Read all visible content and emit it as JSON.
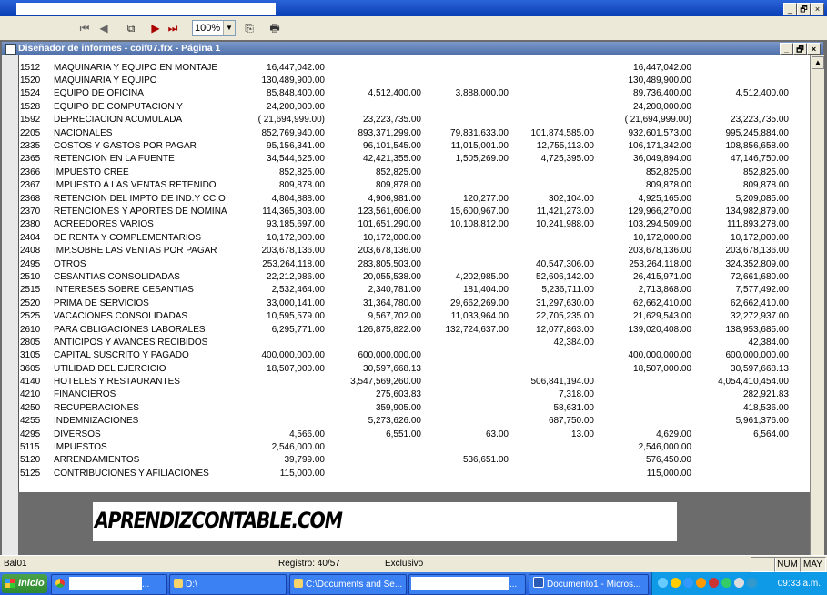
{
  "window": {
    "title": "Diseñador de informes - coif07.frx - Página 1",
    "controls": [
      "_",
      "🗗",
      "×"
    ]
  },
  "toolbar": {
    "zoom": "100%"
  },
  "report": {
    "rows": [
      {
        "code": "1512",
        "name": "MAQUINARIA Y EQUIPO EN MONTAJE",
        "c1": "16,447,042.00",
        "c2": "",
        "c3": "",
        "c4": "",
        "c5": "16,447,042.00",
        "c6": ""
      },
      {
        "code": "1520",
        "name": "MAQUINARIA Y EQUIPO",
        "c1": "130,489,900.00",
        "c2": "",
        "c3": "",
        "c4": "",
        "c5": "130,489,900.00",
        "c6": ""
      },
      {
        "code": "1524",
        "name": "EQUIPO DE OFICINA",
        "c1": "85,848,400.00",
        "c2": "4,512,400.00",
        "c3": "3,888,000.00",
        "c4": "",
        "c5": "89,736,400.00",
        "c6": "4,512,400.00"
      },
      {
        "code": "1528",
        "name": "EQUIPO DE COMPUTACION Y",
        "c1": "24,200,000.00",
        "c2": "",
        "c3": "",
        "c4": "",
        "c5": "24,200,000.00",
        "c6": ""
      },
      {
        "code": "1592",
        "name": "DEPRECIACION ACUMULADA",
        "c1": "(    21,694,999.00)",
        "c2": "23,223,735.00",
        "c3": "",
        "c4": "",
        "c5": "(    21,694,999.00)",
        "c6": "23,223,735.00"
      },
      {
        "code": "2205",
        "name": "NACIONALES",
        "c1": "852,769,940.00",
        "c2": "893,371,299.00",
        "c3": "79,831,633.00",
        "c4": "101,874,585.00",
        "c5": "932,601,573.00",
        "c6": "995,245,884.00"
      },
      {
        "code": "2335",
        "name": "COSTOS Y GASTOS POR PAGAR",
        "c1": "95,156,341.00",
        "c2": "96,101,545.00",
        "c3": "11,015,001.00",
        "c4": "12,755,113.00",
        "c5": "106,171,342.00",
        "c6": "108,856,658.00"
      },
      {
        "code": "2365",
        "name": "RETENCION EN LA FUENTE",
        "c1": "34,544,625.00",
        "c2": "42,421,355.00",
        "c3": "1,505,269.00",
        "c4": "4,725,395.00",
        "c5": "36,049,894.00",
        "c6": "47,146,750.00"
      },
      {
        "code": "2366",
        "name": "IMPUESTO CREE",
        "c1": "852,825.00",
        "c2": "852,825.00",
        "c3": "",
        "c4": "",
        "c5": "852,825.00",
        "c6": "852,825.00"
      },
      {
        "code": "2367",
        "name": "IMPUESTO A LAS VENTAS RETENIDO",
        "c1": "809,878.00",
        "c2": "809,878.00",
        "c3": "",
        "c4": "",
        "c5": "809,878.00",
        "c6": "809,878.00"
      },
      {
        "code": "2368",
        "name": "RETENCION DEL IMPTO DE IND.Y CCIO",
        "c1": "4,804,888.00",
        "c2": "4,906,981.00",
        "c3": "120,277.00",
        "c4": "302,104.00",
        "c5": "4,925,165.00",
        "c6": "5,209,085.00"
      },
      {
        "code": "2370",
        "name": "RETENCIONES Y APORTES DE NOMINA",
        "c1": "114,365,303.00",
        "c2": "123,561,606.00",
        "c3": "15,600,967.00",
        "c4": "11,421,273.00",
        "c5": "129,966,270.00",
        "c6": "134,982,879.00"
      },
      {
        "code": "2380",
        "name": "ACREEDORES VARIOS",
        "c1": "93,185,697.00",
        "c2": "101,651,290.00",
        "c3": "10,108,812.00",
        "c4": "10,241,988.00",
        "c5": "103,294,509.00",
        "c6": "111,893,278.00"
      },
      {
        "code": "2404",
        "name": "DE RENTA Y COMPLEMENTARIOS",
        "c1": "10,172,000.00",
        "c2": "10,172,000.00",
        "c3": "",
        "c4": "",
        "c5": "10,172,000.00",
        "c6": "10,172,000.00"
      },
      {
        "code": "2408",
        "name": "IMP.SOBRE LAS VENTAS POR PAGAR",
        "c1": "203,678,136.00",
        "c2": "203,678,136.00",
        "c3": "",
        "c4": "",
        "c5": "203,678,136.00",
        "c6": "203,678,136.00"
      },
      {
        "code": "2495",
        "name": "OTROS",
        "c1": "253,264,118.00",
        "c2": "283,805,503.00",
        "c3": "",
        "c4": "40,547,306.00",
        "c5": "253,264,118.00",
        "c6": "324,352,809.00"
      },
      {
        "code": "2510",
        "name": "CESANTIAS CONSOLIDADAS",
        "c1": "22,212,986.00",
        "c2": "20,055,538.00",
        "c3": "4,202,985.00",
        "c4": "52,606,142.00",
        "c5": "26,415,971.00",
        "c6": "72,661,680.00"
      },
      {
        "code": "2515",
        "name": "INTERESES SOBRE CESANTIAS",
        "c1": "2,532,464.00",
        "c2": "2,340,781.00",
        "c3": "181,404.00",
        "c4": "5,236,711.00",
        "c5": "2,713,868.00",
        "c6": "7,577,492.00"
      },
      {
        "code": "2520",
        "name": "PRIMA DE SERVICIOS",
        "c1": "33,000,141.00",
        "c2": "31,364,780.00",
        "c3": "29,662,269.00",
        "c4": "31,297,630.00",
        "c5": "62,662,410.00",
        "c6": "62,662,410.00"
      },
      {
        "code": "2525",
        "name": "VACACIONES CONSOLIDADAS",
        "c1": "10,595,579.00",
        "c2": "9,567,702.00",
        "c3": "11,033,964.00",
        "c4": "22,705,235.00",
        "c5": "21,629,543.00",
        "c6": "32,272,937.00"
      },
      {
        "code": "2610",
        "name": "PARA OBLIGACIONES LABORALES",
        "c1": "6,295,771.00",
        "c2": "126,875,822.00",
        "c3": "132,724,637.00",
        "c4": "12,077,863.00",
        "c5": "139,020,408.00",
        "c6": "138,953,685.00"
      },
      {
        "code": "2805",
        "name": "ANTICIPOS Y AVANCES RECIBIDOS",
        "c1": "",
        "c2": "",
        "c3": "",
        "c4": "42,384.00",
        "c5": "",
        "c6": "42,384.00"
      },
      {
        "code": "3105",
        "name": "CAPITAL SUSCRITO Y PAGADO",
        "c1": "400,000,000.00",
        "c2": "600,000,000.00",
        "c3": "",
        "c4": "",
        "c5": "400,000,000.00",
        "c6": "600,000,000.00"
      },
      {
        "code": "3605",
        "name": "UTILIDAD DEL EJERCICIO",
        "c1": "18,507,000.00",
        "c2": "30,597,668.13",
        "c3": "",
        "c4": "",
        "c5": "18,507,000.00",
        "c6": "30,597,668.13"
      },
      {
        "code": "4140",
        "name": "HOTELES Y RESTAURANTES",
        "c1": "",
        "c2": "3,547,569,260.00",
        "c3": "",
        "c4": "506,841,194.00",
        "c5": "",
        "c6": "4,054,410,454.00"
      },
      {
        "code": "4210",
        "name": "FINANCIEROS",
        "c1": "",
        "c2": "275,603.83",
        "c3": "",
        "c4": "7,318.00",
        "c5": "",
        "c6": "282,921.83"
      },
      {
        "code": "4250",
        "name": "RECUPERACIONES",
        "c1": "",
        "c2": "359,905.00",
        "c3": "",
        "c4": "58,631.00",
        "c5": "",
        "c6": "418,536.00"
      },
      {
        "code": "4255",
        "name": "INDEMNIZACIONES",
        "c1": "",
        "c2": "5,273,626.00",
        "c3": "",
        "c4": "687,750.00",
        "c5": "",
        "c6": "5,961,376.00"
      },
      {
        "code": "4295",
        "name": "DIVERSOS",
        "c1": "4,566.00",
        "c2": "6,551.00",
        "c3": "63.00",
        "c4": "13.00",
        "c5": "4,629.00",
        "c6": "6,564.00"
      },
      {
        "code": "5115",
        "name": "IMPUESTOS",
        "c1": "2,546,000.00",
        "c2": "",
        "c3": "",
        "c4": "",
        "c5": "2,546,000.00",
        "c6": ""
      },
      {
        "code": "5120",
        "name": "ARRENDAMIENTOS",
        "c1": "39,799.00",
        "c2": "",
        "c3": "536,651.00",
        "c4": "",
        "c5": "576,450.00",
        "c6": ""
      },
      {
        "code": "5125",
        "name": "CONTRIBUCIONES Y AFILIACIONES",
        "c1": "115,000.00",
        "c2": "",
        "c3": "",
        "c4": "",
        "c5": "115,000.00",
        "c6": ""
      }
    ]
  },
  "watermark": "APRENDIZCONTABLE.COM",
  "statusbar": {
    "left": "Bal01",
    "record": "Registro: 40/57",
    "mode": "Exclusivo",
    "num": "NUM",
    "may": "MAY"
  },
  "taskbar": {
    "start": "Inicio",
    "tasks": [
      {
        "label": "..."
      },
      {
        "label": "D:\\"
      },
      {
        "label": "C:\\Documents and Se..."
      },
      {
        "label": "..."
      },
      {
        "label": "Documento1 - Micros..."
      }
    ],
    "clock": "09:33 a.m."
  },
  "colors": {
    "titlebar": "#0a3fb5",
    "report_title": "#4d6ea8",
    "workspace": "#6c6c6c",
    "taskbar": "#245edb",
    "tray": "#0f9ae8"
  }
}
